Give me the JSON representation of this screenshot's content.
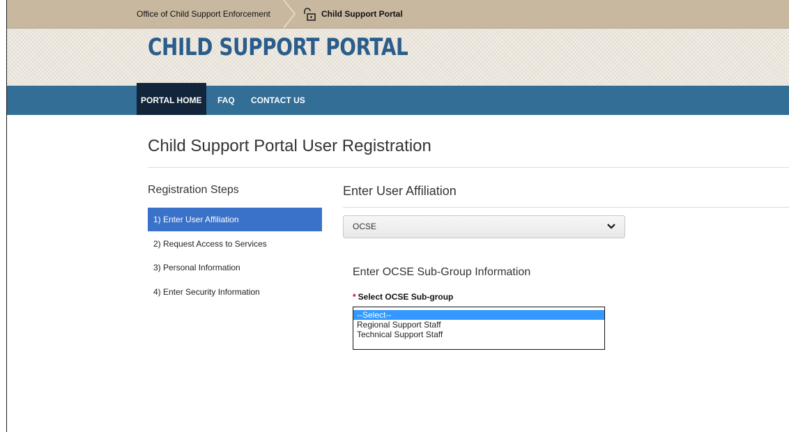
{
  "breadcrumb": {
    "items": [
      "Office of Child Support Enforcement",
      "Child Support Portal"
    ]
  },
  "header": {
    "title": "CHILD SUPPORT PORTAL"
  },
  "nav": {
    "items": [
      {
        "label": "PORTAL HOME",
        "active": true
      },
      {
        "label": "FAQ",
        "active": false
      },
      {
        "label": "CONTACT US",
        "active": false
      }
    ]
  },
  "page": {
    "title": "Child Support Portal User Registration"
  },
  "steps": {
    "heading": "Registration Steps",
    "items": [
      {
        "label": "1) Enter User Affiliation",
        "active": true
      },
      {
        "label": "2) Request Access to Services",
        "active": false
      },
      {
        "label": "3) Personal Information",
        "active": false
      },
      {
        "label": "4) Enter Security Information",
        "active": false
      }
    ]
  },
  "affiliation": {
    "heading": "Enter User Affiliation",
    "selected": "OCSE"
  },
  "subgroup": {
    "heading": "Enter OCSE Sub-Group Information",
    "required_mark": "*",
    "label": "Select OCSE Sub-group",
    "options": [
      "--Select--",
      "Regional Support Staff",
      "Technical Support Staff"
    ],
    "selected_index": 0
  },
  "colors": {
    "nav_bar": "#336e96",
    "nav_active": "#12253a",
    "step_active": "#3a72c9",
    "title": "#2b5d8a",
    "option_highlight": "#3399ff"
  },
  "icons": {
    "breadcrumb_separator": "chevron-right-icon",
    "portal": "unlock-icon",
    "dropdown": "chevron-down-icon"
  }
}
